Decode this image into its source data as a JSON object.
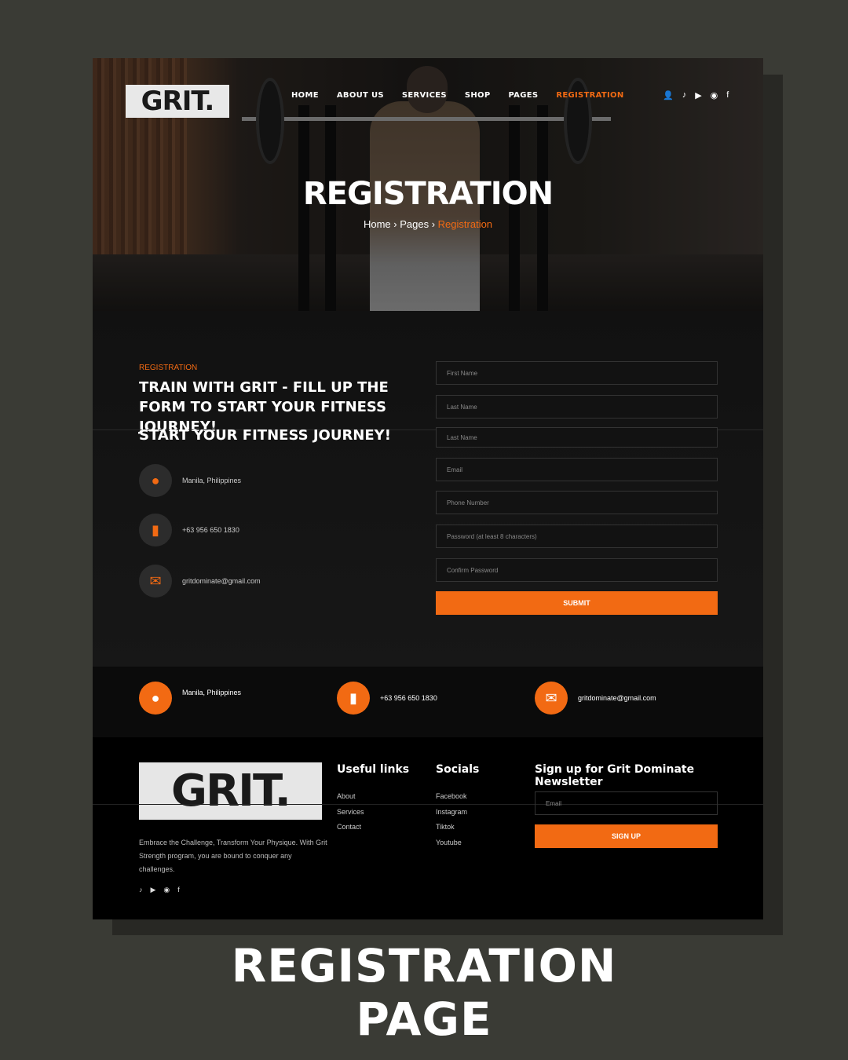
{
  "header": {
    "logo_text": "GRIT.",
    "nav": [
      "HOME",
      "ABOUT US",
      "SERVICES",
      "SHOP",
      "PAGES",
      "REGISTRATION"
    ],
    "icons": [
      "user-icon",
      "tiktok-icon",
      "youtube-icon",
      "instagram-icon",
      "facebook-icon"
    ]
  },
  "hero": {
    "title": "REGISTRATION",
    "breadcrumb": {
      "home": "Home",
      "pages": "Pages",
      "current": "Registration"
    }
  },
  "form_section": {
    "eyebrow": "REGISTRATION",
    "headline": "TRAIN WITH GRIT - FILL UP THE FORM TO START YOUR FITNESS JOURNEY!",
    "headline_dup": "START YOUR FITNESS JOURNEY!",
    "contact": {
      "address": "Manila, Philippines",
      "phone": "+63 956 650 1830",
      "email": "gritdominate@gmail.com"
    },
    "fields": {
      "first_name": "First Name",
      "last_name": "Last Name",
      "last_name_dup": "Last Name",
      "email": "Email",
      "phone": "Phone Number",
      "password": "Password (at least 8 characters)",
      "confirm": "Confirm Password"
    },
    "submit": "SUBMIT"
  },
  "strip": {
    "address": "Manila, Philippines",
    "phone": "+63 956 650 1830",
    "email": "gritdominate@gmail.com"
  },
  "footer": {
    "logo_text": "GRIT.",
    "description": "Embrace the Challenge, Transform Your Physique. With Grit Strength program, you are bound to conquer any challenges.",
    "useful_links_title": "Useful links",
    "useful_links": [
      "About",
      "Services",
      "Contact"
    ],
    "socials_title": "Socials",
    "socials": [
      "Facebook",
      "Instagram",
      "Tiktok",
      "Youtube"
    ],
    "newsletter_title": "Sign up for Grit Dominate Newsletter",
    "newsletter_placeholder": "Email",
    "newsletter_button": "SIGN UP"
  },
  "caption": {
    "line1": "REGISTRATION",
    "line2": "PAGE"
  },
  "colors": {
    "accent": "#f26a13",
    "background": "#3a3b35",
    "panel": "#121212"
  }
}
